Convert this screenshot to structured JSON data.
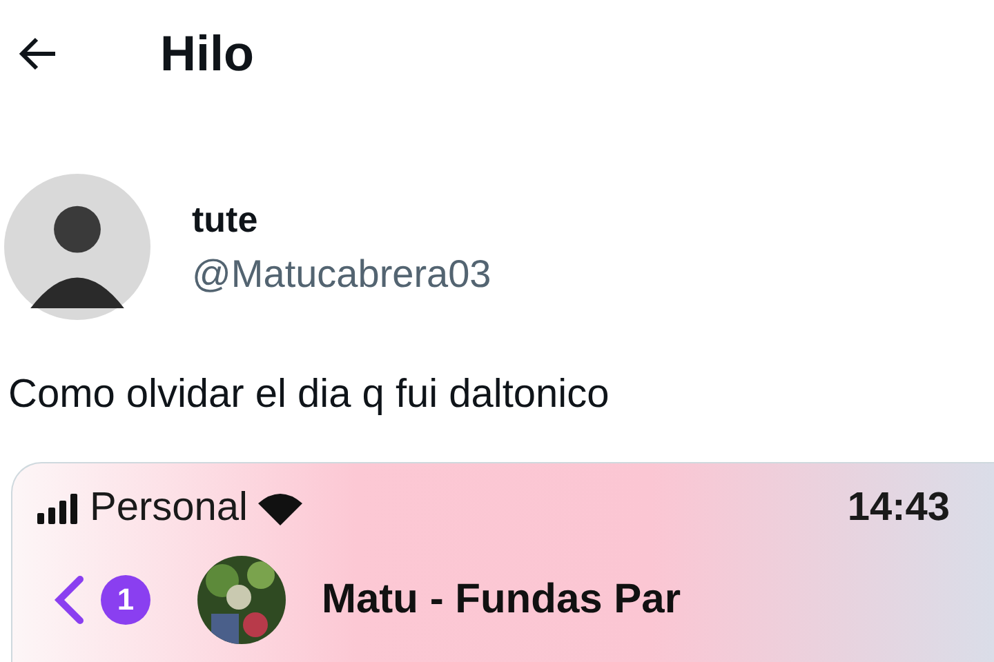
{
  "header": {
    "title": "Hilo"
  },
  "author": {
    "name": "tute",
    "handle": "@Matucabrera03"
  },
  "tweet": {
    "text": "Como olvidar el dia q fui daltonico"
  },
  "embedded_screenshot": {
    "carrier": "Personal",
    "time": "14:43",
    "unread_badge": "1",
    "chat_name": "Matu - Fundas Par"
  }
}
